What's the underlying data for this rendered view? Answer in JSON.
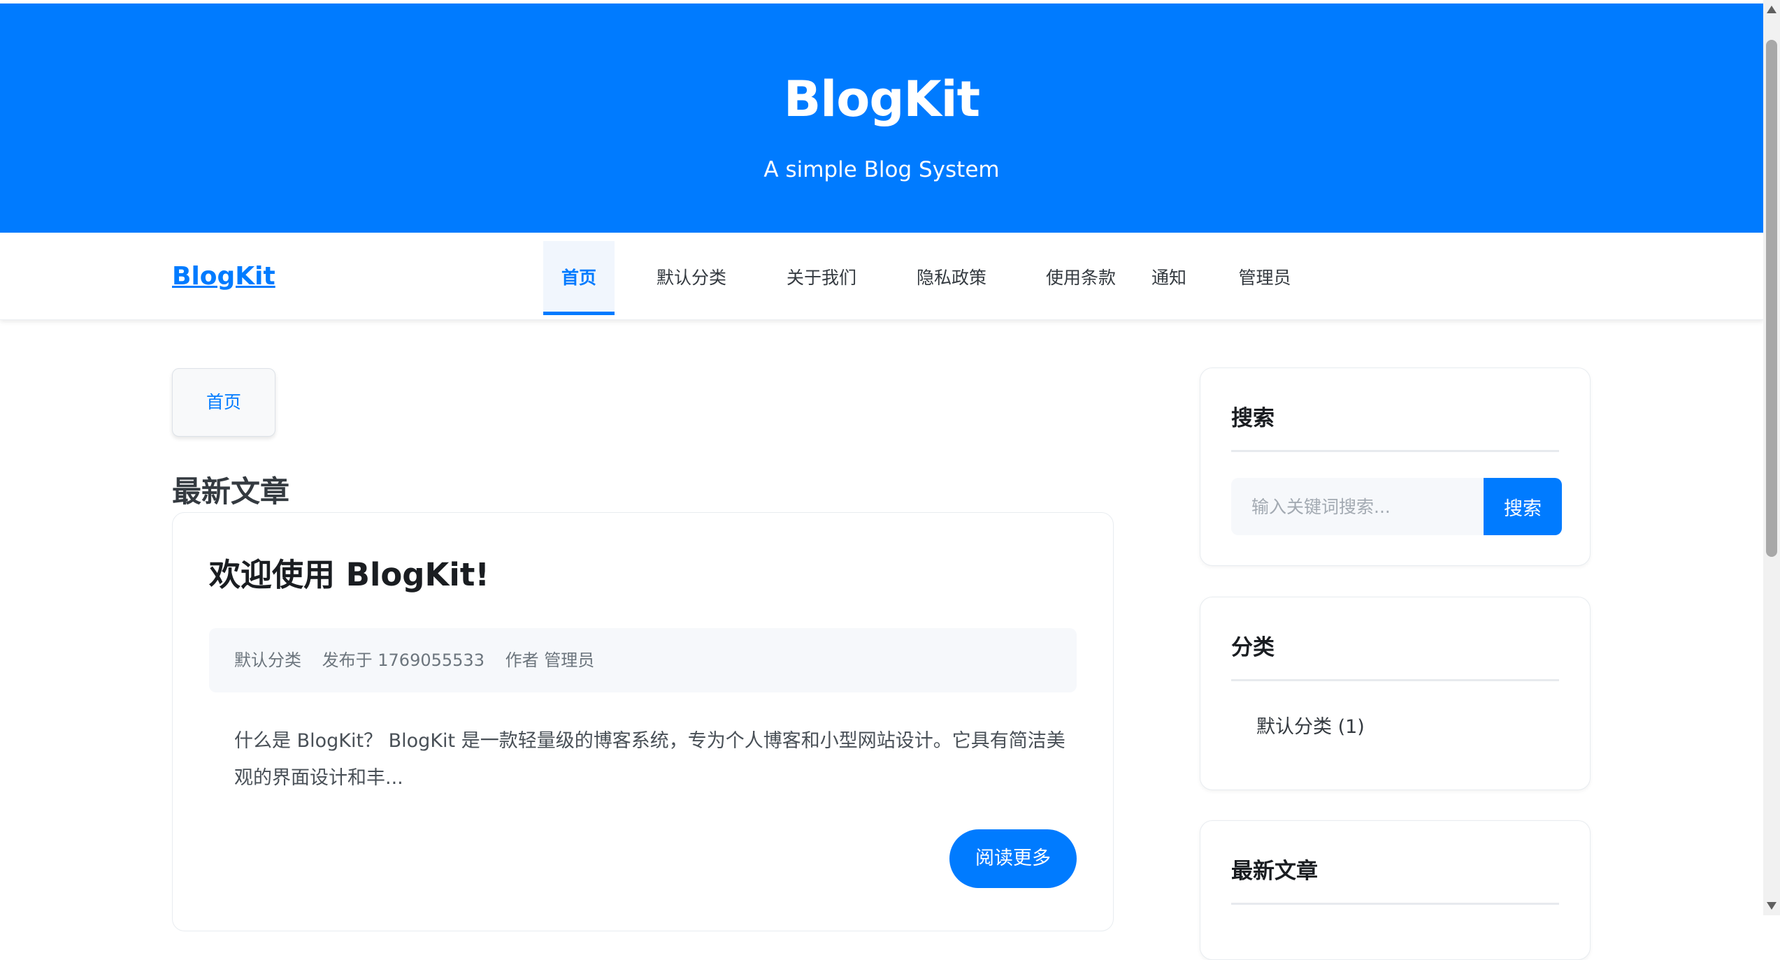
{
  "header": {
    "title": "BlogKit",
    "subtitle": "A simple Blog System"
  },
  "navbar": {
    "brand": "BlogKit",
    "items": [
      {
        "label": "首页",
        "active": true
      },
      {
        "label": "默认分类",
        "active": false
      },
      {
        "label": "关于我们",
        "active": false
      },
      {
        "label": "隐私政策",
        "active": false
      },
      {
        "label": "使用条款",
        "active": false
      },
      {
        "label": "通知",
        "active": false
      },
      {
        "label": "管理员",
        "active": false
      }
    ]
  },
  "breadcrumb": {
    "current": "首页"
  },
  "main": {
    "section_title": "最新文章",
    "posts": [
      {
        "title": "欢迎使用 BlogKit!",
        "category": "默认分类",
        "published": "发布于 1769055533",
        "author": "作者 管理员",
        "excerpt": "什么是 BlogKit？ BlogKit 是一款轻量级的博客系统，专为个人博客和小型网站设计。它具有简洁美观的界面设计和丰...",
        "read_more": "阅读更多"
      }
    ]
  },
  "sidebar": {
    "search": {
      "title": "搜索",
      "placeholder": "输入关键词搜索...",
      "button": "搜索"
    },
    "categories": {
      "title": "分类",
      "items": [
        {
          "label": "默认分类 (1)"
        }
      ]
    },
    "recent": {
      "title": "最新文章"
    }
  },
  "colors": {
    "primary": "#007bff",
    "page_background": "#ffffff",
    "meta_background": "#f6f8fb"
  }
}
